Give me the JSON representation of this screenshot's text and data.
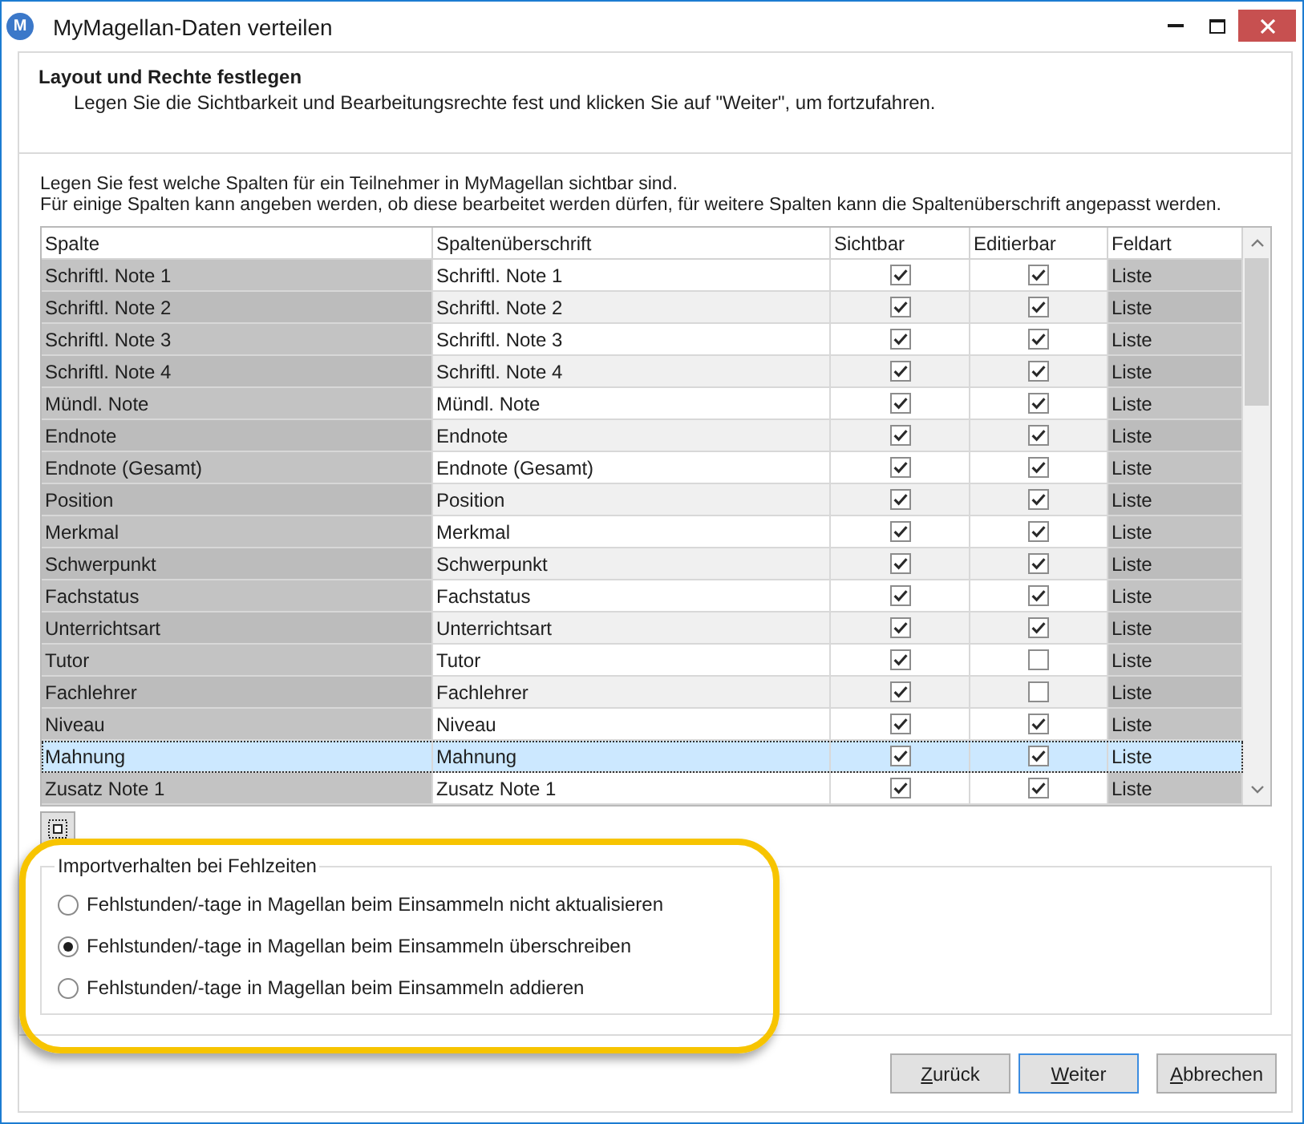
{
  "window": {
    "logo": "M",
    "title": "MyMagellan-Daten verteilen"
  },
  "header": {
    "title": "Layout und Rechte festlegen",
    "subtitle": "Legen Sie die Sichtbarkeit und Bearbeitungsrechte fest und klicken Sie auf \"Weiter\", um fortzufahren."
  },
  "intro": [
    "Legen Sie fest welche Spalten für ein Teilnehmer in MyMagellan sichtbar sind.",
    "Für einige Spalten kann angeben werden, ob diese bearbeitet werden dürfen, für weitere Spalten kann die Spaltenüberschrift angepasst werden."
  ],
  "table": {
    "columns": [
      "Spalte",
      "Spaltenüberschrift",
      "Sichtbar",
      "Editierbar",
      "Feldart"
    ],
    "rows": [
      {
        "column": "Schriftl. Note 1",
        "heading": "Schriftl. Note 1",
        "visible": true,
        "editable": true,
        "field_type": "Liste",
        "selected": false
      },
      {
        "column": "Schriftl. Note 2",
        "heading": "Schriftl. Note 2",
        "visible": true,
        "editable": true,
        "field_type": "Liste",
        "selected": false
      },
      {
        "column": "Schriftl. Note 3",
        "heading": "Schriftl. Note 3",
        "visible": true,
        "editable": true,
        "field_type": "Liste",
        "selected": false
      },
      {
        "column": "Schriftl. Note 4",
        "heading": "Schriftl. Note 4",
        "visible": true,
        "editable": true,
        "field_type": "Liste",
        "selected": false
      },
      {
        "column": "Mündl. Note",
        "heading": "Mündl. Note",
        "visible": true,
        "editable": true,
        "field_type": "Liste",
        "selected": false
      },
      {
        "column": "Endnote",
        "heading": "Endnote",
        "visible": true,
        "editable": true,
        "field_type": "Liste",
        "selected": false
      },
      {
        "column": "Endnote (Gesamt)",
        "heading": "Endnote (Gesamt)",
        "visible": true,
        "editable": true,
        "field_type": "Liste",
        "selected": false
      },
      {
        "column": "Position",
        "heading": "Position",
        "visible": true,
        "editable": true,
        "field_type": "Liste",
        "selected": false
      },
      {
        "column": "Merkmal",
        "heading": "Merkmal",
        "visible": true,
        "editable": true,
        "field_type": "Liste",
        "selected": false
      },
      {
        "column": "Schwerpunkt",
        "heading": "Schwerpunkt",
        "visible": true,
        "editable": true,
        "field_type": "Liste",
        "selected": false
      },
      {
        "column": "Fachstatus",
        "heading": "Fachstatus",
        "visible": true,
        "editable": true,
        "field_type": "Liste",
        "selected": false
      },
      {
        "column": "Unterrichtsart",
        "heading": "Unterrichtsart",
        "visible": true,
        "editable": true,
        "field_type": "Liste",
        "selected": false
      },
      {
        "column": "Tutor",
        "heading": "Tutor",
        "visible": true,
        "editable": false,
        "field_type": "Liste",
        "selected": false
      },
      {
        "column": "Fachlehrer",
        "heading": "Fachlehrer",
        "visible": true,
        "editable": false,
        "field_type": "Liste",
        "selected": false
      },
      {
        "column": "Niveau",
        "heading": "Niveau",
        "visible": true,
        "editable": true,
        "field_type": "Liste",
        "selected": false
      },
      {
        "column": "Mahnung",
        "heading": "Mahnung",
        "visible": true,
        "editable": true,
        "field_type": "Liste",
        "selected": true
      },
      {
        "column": "Zusatz Note 1",
        "heading": "Zusatz Note 1",
        "visible": true,
        "editable": true,
        "field_type": "Liste",
        "selected": false
      }
    ]
  },
  "absence_import": {
    "title": "Importverhalten bei Fehlzeiten",
    "options": [
      {
        "label": "Fehlstunden/-tage in Magellan beim Einsammeln nicht aktualisieren",
        "selected": false
      },
      {
        "label": "Fehlstunden/-tage in Magellan beim Einsammeln überschreiben",
        "selected": true
      },
      {
        "label": "Fehlstunden/-tage in Magellan beim Einsammeln addieren",
        "selected": false
      }
    ]
  },
  "buttons": [
    {
      "label": "Zurück",
      "default": false
    },
    {
      "label": "Weiter",
      "default": true
    },
    {
      "label": "Abbrechen",
      "default": false
    }
  ]
}
